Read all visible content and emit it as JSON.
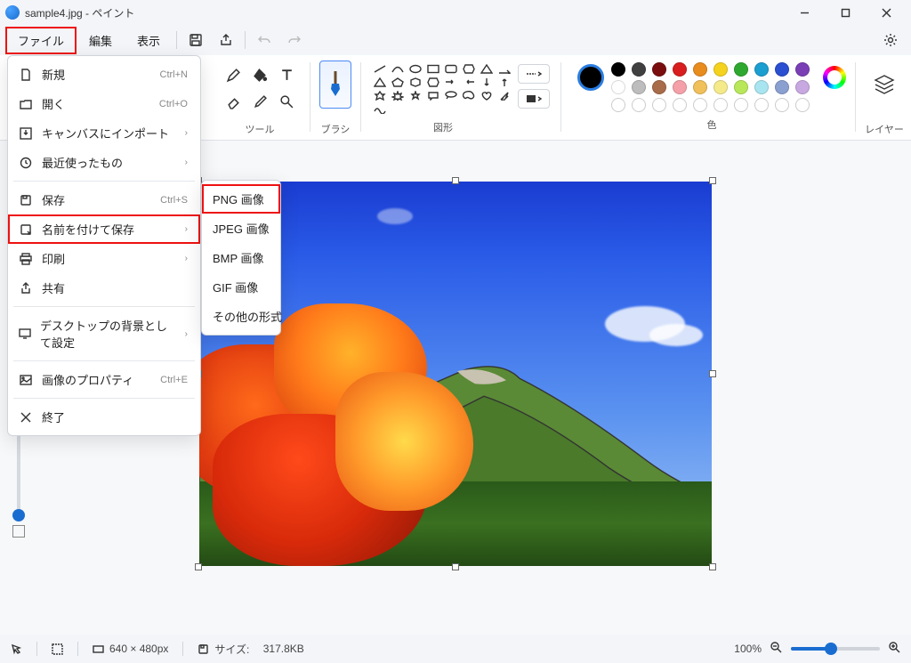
{
  "title": "sample4.jpg - ペイント",
  "menubar": {
    "file": "ファイル",
    "edit": "編集",
    "view": "表示"
  },
  "ribbon": {
    "tools_label": "ツール",
    "brushes_label": "ブラシ",
    "shapes_label": "図形",
    "colors_label": "色",
    "layers_label": "レイヤー"
  },
  "file_menu": {
    "new": "新規",
    "new_sc": "Ctrl+N",
    "open": "開く",
    "open_sc": "Ctrl+O",
    "import": "キャンバスにインポート",
    "recent": "最近使ったもの",
    "save": "保存",
    "save_sc": "Ctrl+S",
    "save_as": "名前を付けて保存",
    "print": "印刷",
    "share": "共有",
    "set_desktop": "デスクトップの背景として設定",
    "properties": "画像のプロパティ",
    "properties_sc": "Ctrl+E",
    "exit": "終了"
  },
  "submenu": {
    "png": "PNG 画像",
    "jpeg": "JPEG 画像",
    "bmp": "BMP 画像",
    "gif": "GIF 画像",
    "other": "その他の形式"
  },
  "palette_row1": [
    "#000000",
    "#404040",
    "#7a0e0e",
    "#d81e1e",
    "#e88c1e",
    "#f5d21e",
    "#2fa82f",
    "#1b9ed0",
    "#2a4fd0",
    "#7a3fb5"
  ],
  "palette_row2": [
    "#ffffff",
    "#bdbdbd",
    "#a86c4a",
    "#f5a0a8",
    "#f0c05a",
    "#f5ea8a",
    "#b8e85a",
    "#a8e5f0",
    "#8aa0d0",
    "#c8a8e0"
  ],
  "statusbar": {
    "dimensions": "640 × 480px",
    "size_label": "サイズ:",
    "size_value": "317.8KB",
    "zoom": "100%"
  }
}
